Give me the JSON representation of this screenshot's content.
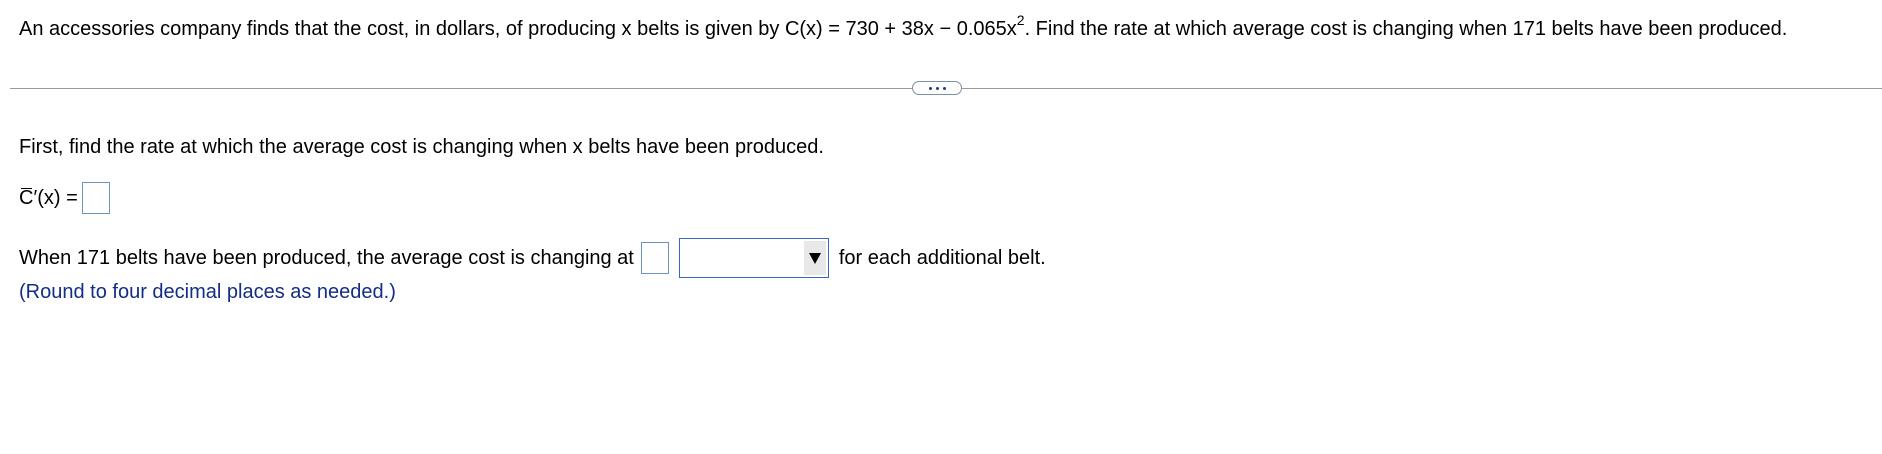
{
  "question": {
    "prefix": "An accessories company finds that the cost, in dollars, of producing x belts is given by ",
    "formula_base": "C(x) = 730 + 38x − 0.065x",
    "formula_exponent": "2",
    "suffix": ". Find the rate at which average cost is changing when 171 belts have been produced."
  },
  "more_button": {
    "icon": "ellipsis-icon"
  },
  "step": {
    "instruction": "First, find the rate at which the average cost is changing when x belts have been produced.",
    "answer_label_c": "C",
    "answer_label_rest": "′(x) =",
    "answer_value": ""
  },
  "sentence": {
    "before": "When 171 belts have been produced, the average cost is changing at",
    "value": "",
    "dropdown_selected": "",
    "after": "for each additional belt."
  },
  "hint": "(Round to four decimal places as needed.)",
  "colors": {
    "hint": "#142d86",
    "input_border": "#6a93c9",
    "dropdown_border": "#3a66c4"
  }
}
